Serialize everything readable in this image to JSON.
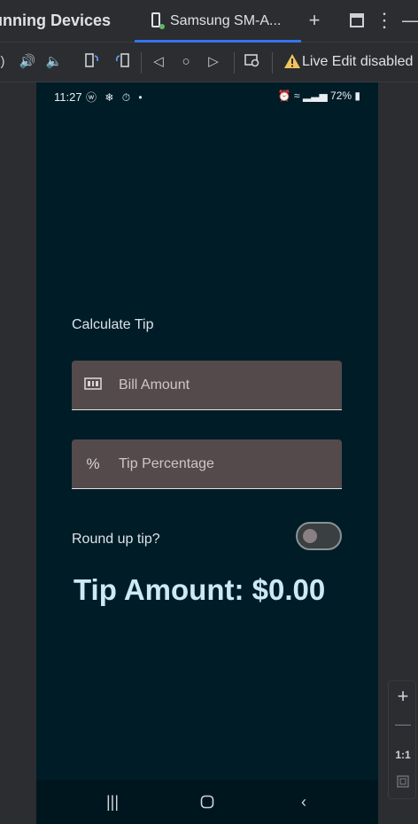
{
  "tabbar": {
    "title": "unning Devices",
    "device_tab_label": "Samsung SM-A...",
    "icons": [
      "plus-icon",
      "window-icon",
      "more-vert-icon",
      "minimize-icon"
    ]
  },
  "toolbar": {
    "live_edit_label": "Live Edit disabled"
  },
  "status_bar": {
    "time": "11:27",
    "left_icons": "ⓦ ❄ ⏱ •",
    "battery": "72%"
  },
  "app": {
    "heading": "Calculate Tip",
    "bill_amount_placeholder": "Bill Amount",
    "bill_icon": "money-icon",
    "tip_percentage_placeholder": "Tip Percentage",
    "tip_icon": "percent-icon",
    "round_up_label": "Round up tip?",
    "round_up_checked": false,
    "tip_amount_text": "Tip Amount: $0.00"
  },
  "zoom": {
    "one_to_one": "1:1"
  },
  "colors": {
    "accent": "#3574f0",
    "screen_bg": "#001c27",
    "field_bg": "#544a4c",
    "tip_text": "#cde9f6"
  }
}
